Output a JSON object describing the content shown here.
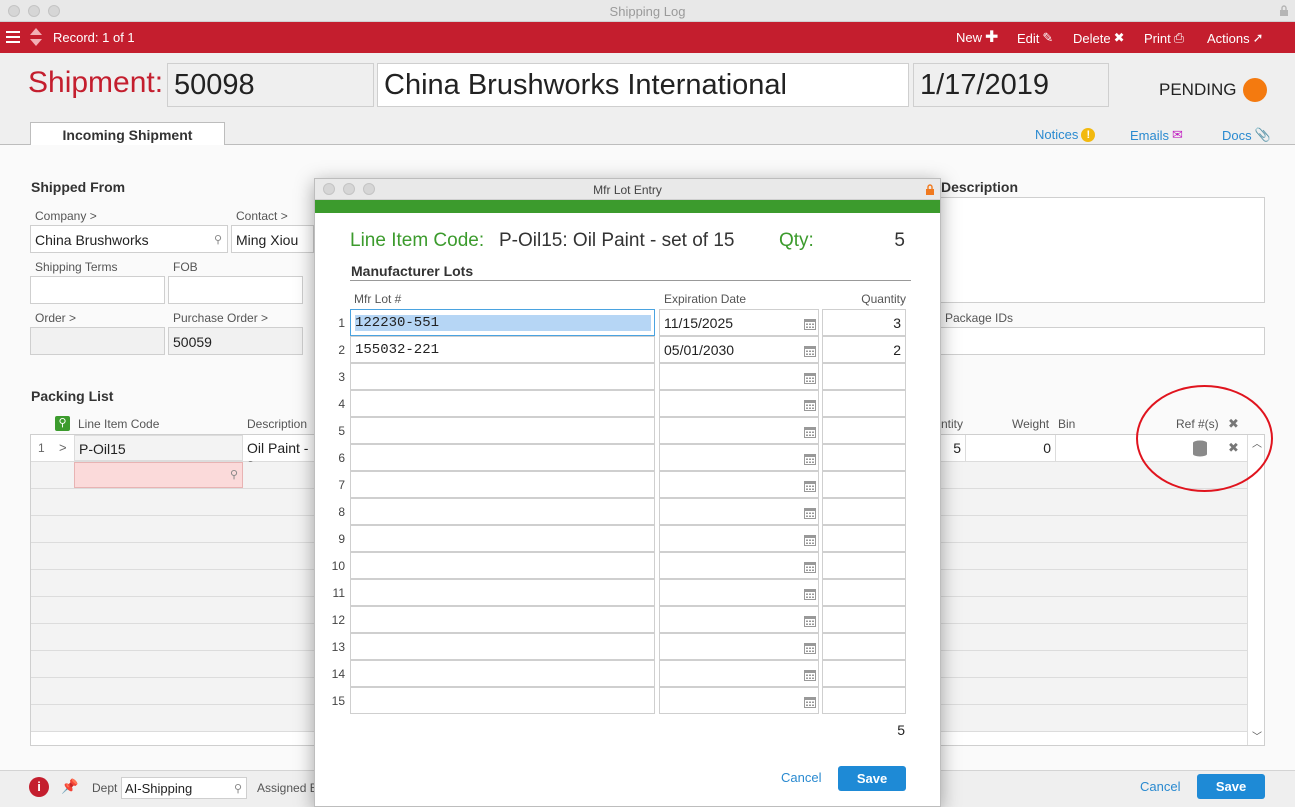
{
  "window": {
    "title": "Shipping Log"
  },
  "toolbar": {
    "record": "Record: 1 of 1",
    "new": "New",
    "edit": "Edit",
    "delete": "Delete",
    "print": "Print",
    "actions": "Actions"
  },
  "header": {
    "label": "Shipment:",
    "number": "50098",
    "company": "China Brushworks International",
    "date": "1/17/2019",
    "status": "PENDING",
    "status_color": "#f47a0f"
  },
  "tabs": {
    "active": "Incoming Shipment"
  },
  "links": {
    "notices": "Notices",
    "emails": "Emails",
    "docs": "Docs"
  },
  "shipped_from": {
    "title": "Shipped From",
    "company_label": "Company >",
    "company_value": "China Brushworks",
    "contact_label": "Contact >",
    "contact_value": "Ming Xiou",
    "shipping_terms_label": "Shipping Terms",
    "fob_label": "FOB",
    "order_label": "Order >",
    "purchase_order_label": "Purchase Order >",
    "purchase_order_value": "50059"
  },
  "description": {
    "title": "Description",
    "package_ids_label": "Package IDs"
  },
  "packing_list": {
    "title": "Packing List",
    "headers": {
      "line_item_code": "Line Item Code",
      "description": "Description",
      "qty": "ntity",
      "weight": "Weight",
      "bin": "Bin",
      "ref": "Ref #(s)"
    },
    "row": {
      "num": "1",
      "arrow": ">",
      "code": "P-Oil15",
      "description": "Oil Paint - s",
      "qty": "5",
      "weight": "0"
    }
  },
  "footer": {
    "dept_label": "Dept",
    "dept_value": "AI-Shipping",
    "assigned_label": "Assigned B",
    "cancel": "Cancel",
    "save": "Save"
  },
  "modal": {
    "title": "Mfr Lot Entry",
    "code_label": "Line Item Code:",
    "code_value": "P-Oil15: Oil Paint - set of 15",
    "qty_label": "Qty:",
    "qty_value": "5",
    "section": "Manufacturer Lots",
    "headers": {
      "lot": "Mfr Lot #",
      "exp": "Expiration Date",
      "qty": "Quantity"
    },
    "rows": [
      {
        "num": "1",
        "lot": "122230-551",
        "exp": "11/15/2025",
        "qty": "3"
      },
      {
        "num": "2",
        "lot": "155032-221",
        "exp": "05/01/2030",
        "qty": "2"
      },
      {
        "num": "3",
        "lot": "",
        "exp": "",
        "qty": ""
      },
      {
        "num": "4",
        "lot": "",
        "exp": "",
        "qty": ""
      },
      {
        "num": "5",
        "lot": "",
        "exp": "",
        "qty": ""
      },
      {
        "num": "6",
        "lot": "",
        "exp": "",
        "qty": ""
      },
      {
        "num": "7",
        "lot": "",
        "exp": "",
        "qty": ""
      },
      {
        "num": "8",
        "lot": "",
        "exp": "",
        "qty": ""
      },
      {
        "num": "9",
        "lot": "",
        "exp": "",
        "qty": ""
      },
      {
        "num": "10",
        "lot": "",
        "exp": "",
        "qty": ""
      },
      {
        "num": "11",
        "lot": "",
        "exp": "",
        "qty": ""
      },
      {
        "num": "12",
        "lot": "",
        "exp": "",
        "qty": ""
      },
      {
        "num": "13",
        "lot": "",
        "exp": "",
        "qty": ""
      },
      {
        "num": "14",
        "lot": "",
        "exp": "",
        "qty": ""
      },
      {
        "num": "15",
        "lot": "",
        "exp": "",
        "qty": ""
      }
    ],
    "total": "5",
    "cancel": "Cancel",
    "save": "Save"
  }
}
